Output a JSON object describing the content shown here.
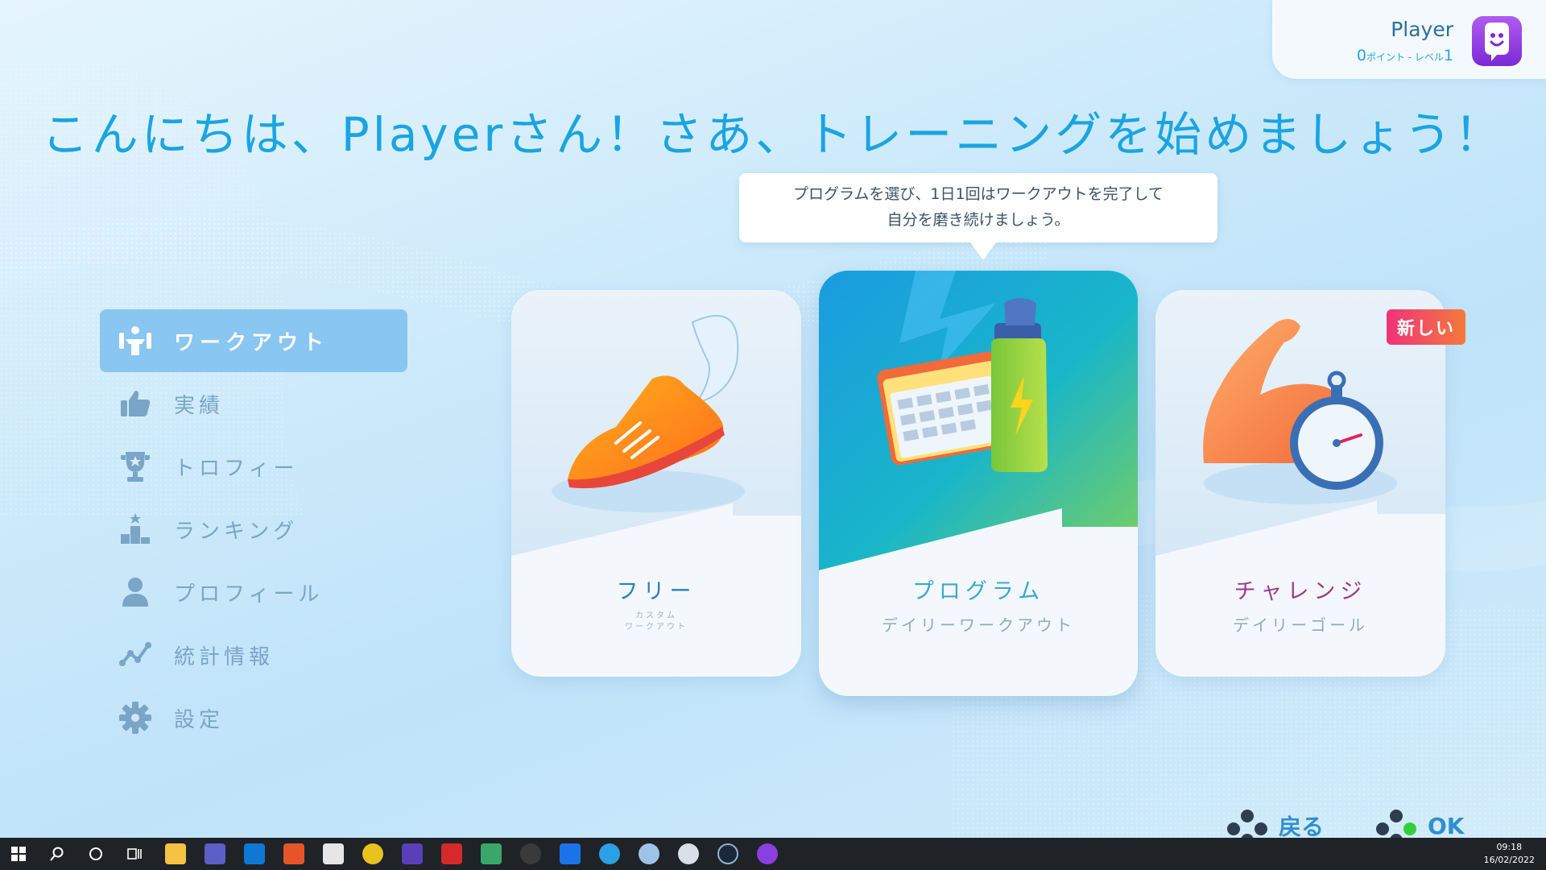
{
  "player": {
    "name": "Player",
    "points_value": "0",
    "points_label": "ポイント - レベル",
    "level_value": "1"
  },
  "greeting": "こんにちは、Playerさん！さあ、トレーニングを始めましょう！",
  "tooltip": {
    "line1": "プログラムを選び、1日1回はワークアウトを完了して",
    "line2": "自分を磨き続けましょう。"
  },
  "sidebar": {
    "items": [
      {
        "label": "ワークアウト",
        "icon": "dumbbell-icon"
      },
      {
        "label": "実績",
        "icon": "thumbs-up-icon"
      },
      {
        "label": "トロフィー",
        "icon": "trophy-icon"
      },
      {
        "label": "ランキング",
        "icon": "podium-icon"
      },
      {
        "label": "プロフィール",
        "icon": "person-icon"
      },
      {
        "label": "統計情報",
        "icon": "stats-icon"
      },
      {
        "label": "設定",
        "icon": "gear-icon"
      }
    ]
  },
  "cards": {
    "free": {
      "title": "フリー",
      "sub1": "カスタム",
      "sub2": "ワークアウト",
      "title_color": "#2a7fbf"
    },
    "program": {
      "title": "プログラム",
      "subtitle": "デイリーワークアウト",
      "title_color": "#3aa7d6"
    },
    "challenge": {
      "title": "チャレンジ",
      "subtitle": "デイリーゴール",
      "badge": "新しい",
      "title_color": "#9b3a8c"
    }
  },
  "controls": {
    "back_label": "戻る",
    "ok_label": "OK"
  },
  "taskbar": {
    "time": "09:18",
    "date": "16/02/2022"
  }
}
